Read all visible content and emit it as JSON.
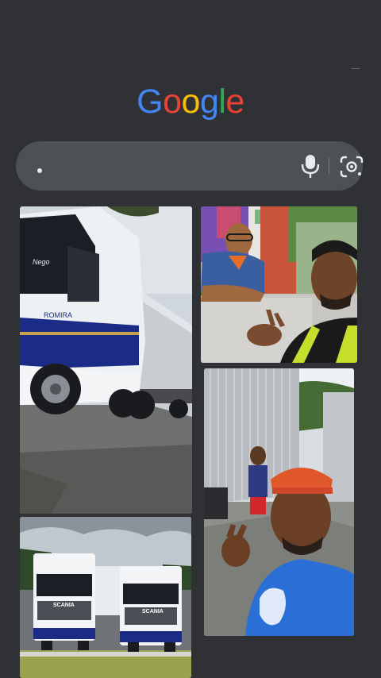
{
  "logo": {
    "letters": [
      "G",
      "o",
      "o",
      "g",
      "l",
      "e"
    ],
    "colors": [
      "#4285F4",
      "#EA4335",
      "#FBBC05",
      "#4285F4",
      "#34A853",
      "#EA4335"
    ]
  },
  "search": {
    "query": "",
    "mic_icon": "mic-icon",
    "lens_icon": "google-lens-icon"
  },
  "results": {
    "left_column": [
      {
        "name": "truck-scania-side",
        "texts": [
          "Nego",
          "ROMIRA"
        ]
      },
      {
        "name": "two-scania-trucks",
        "texts": [
          "SCANIA",
          "SCANIA"
        ]
      }
    ],
    "right_column": [
      {
        "name": "selfie-two-men"
      },
      {
        "name": "selfie-with-trailers"
      }
    ]
  },
  "colors": {
    "background": "#303134",
    "search_bar": "#4d5156",
    "icon": "#e8eaed",
    "truck_blue": "#1b2c86"
  }
}
